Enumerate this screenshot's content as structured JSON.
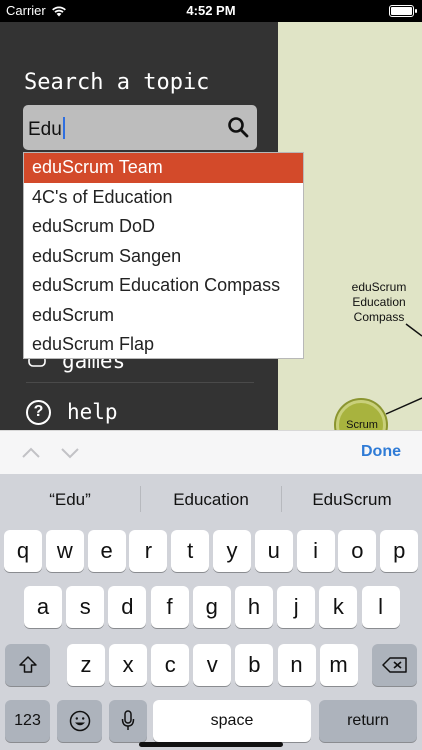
{
  "status": {
    "carrier": "Carrier",
    "time": "4:52 PM",
    "battery_level": 1.0
  },
  "sidebar": {
    "heading": "Search a topic",
    "search": {
      "value": "Edu"
    },
    "menu": [
      {
        "label": "games",
        "icon": "games-icon"
      },
      {
        "label": "help",
        "icon": "help-icon",
        "glyph": "?"
      }
    ]
  },
  "dropdown": {
    "items": [
      "eduScrum Team",
      "4C's of Education",
      "eduScrum DoD",
      "eduScrum Sangen",
      "eduScrum Education Compass",
      "eduScrum",
      "eduScrum Flap"
    ],
    "selected_index": 0,
    "accent": "#d34a2a"
  },
  "map": {
    "node_label_lines": [
      "eduScrum",
      "Education",
      "Compass"
    ],
    "scrum_node_label": "Scrum",
    "background": "#e0e4c6"
  },
  "keyboard": {
    "toolbar": {
      "done_label": "Done"
    },
    "suggestions": [
      "“Edu”",
      "Education",
      "EduScrum"
    ],
    "rows": [
      [
        "q",
        "w",
        "e",
        "r",
        "t",
        "y",
        "u",
        "i",
        "o",
        "p"
      ],
      [
        "a",
        "s",
        "d",
        "f",
        "g",
        "h",
        "j",
        "k",
        "l"
      ],
      [
        "z",
        "x",
        "c",
        "v",
        "b",
        "n",
        "m"
      ]
    ],
    "numbers_label": "123",
    "space_label": "space",
    "return_label": "return"
  }
}
